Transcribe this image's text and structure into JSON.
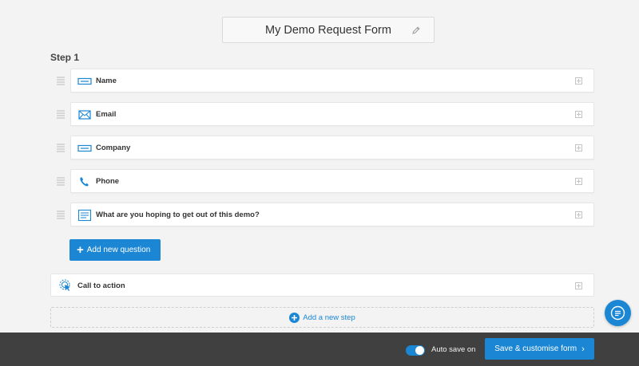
{
  "form": {
    "title": "My Demo Request Form"
  },
  "step": {
    "label": "Step 1"
  },
  "questions": [
    {
      "label": "Name",
      "icon": "text-field-icon"
    },
    {
      "label": "Email",
      "icon": "envelope-icon"
    },
    {
      "label": "Company",
      "icon": "text-field-icon"
    },
    {
      "label": "Phone",
      "icon": "phone-icon"
    },
    {
      "label": "What are you hoping to get out of this demo?",
      "icon": "paragraph-icon"
    }
  ],
  "buttons": {
    "add_question": "Add new question",
    "add_step": "Add a new step",
    "save": "Save & customise form"
  },
  "cta": {
    "label": "Call to action",
    "icon": "target-pointer-icon"
  },
  "footer": {
    "autosave_label": "Auto save on",
    "autosave_on": true
  },
  "colors": {
    "accent": "#1a86d4",
    "footer_bg": "#404040",
    "page_bg": "#f3f3f3"
  }
}
